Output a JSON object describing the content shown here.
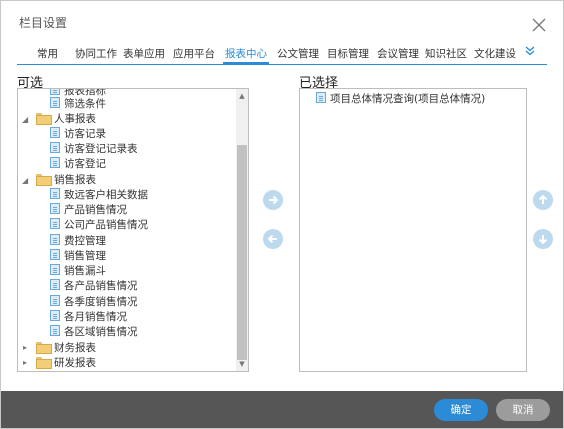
{
  "dialog": {
    "title": "栏目设置"
  },
  "tabs": [
    {
      "label": "常用",
      "active": false
    },
    {
      "label": "协同工作",
      "active": false
    },
    {
      "label": "表单应用",
      "active": false
    },
    {
      "label": "应用平台",
      "active": false
    },
    {
      "label": "报表中心",
      "active": true
    },
    {
      "label": "公文管理",
      "active": false
    },
    {
      "label": "目标管理",
      "active": false
    },
    {
      "label": "会议管理",
      "active": false
    },
    {
      "label": "知识社区",
      "active": false
    },
    {
      "label": "文化建设",
      "active": false
    }
  ],
  "labels": {
    "available": "可选",
    "selected": "已选择"
  },
  "available_tree": [
    {
      "type": "file",
      "label": "报表指标",
      "level": 2
    },
    {
      "type": "file",
      "label": "筛选条件",
      "level": 2
    },
    {
      "type": "folder",
      "label": "人事报表",
      "level": 1,
      "expanded": true
    },
    {
      "type": "file",
      "label": "访客记录",
      "level": 2
    },
    {
      "type": "file",
      "label": "访客登记记录表",
      "level": 2
    },
    {
      "type": "file",
      "label": "访客登记",
      "level": 2
    },
    {
      "type": "folder",
      "label": "销售报表",
      "level": 1,
      "expanded": true
    },
    {
      "type": "file",
      "label": "致远客户相关数据",
      "level": 2
    },
    {
      "type": "file",
      "label": "产品销售情况",
      "level": 2
    },
    {
      "type": "file",
      "label": "公司产品销售情况",
      "level": 2
    },
    {
      "type": "file",
      "label": "费控管理",
      "level": 2
    },
    {
      "type": "file",
      "label": "销售管理",
      "level": 2
    },
    {
      "type": "file",
      "label": "销售漏斗",
      "level": 2
    },
    {
      "type": "file",
      "label": "各产品销售情况",
      "level": 2
    },
    {
      "type": "file",
      "label": "各季度销售情况",
      "level": 2
    },
    {
      "type": "file",
      "label": "各月销售情况",
      "level": 2
    },
    {
      "type": "file",
      "label": "各区域销售情况",
      "level": 2
    },
    {
      "type": "folder",
      "label": "财务报表",
      "level": 1,
      "expanded": false
    },
    {
      "type": "folder",
      "label": "研发报表",
      "level": 1,
      "expanded": false
    }
  ],
  "selected_list": [
    {
      "label": "项目总体情况查询(项目总体情况)"
    }
  ],
  "buttons": {
    "ok": "确定",
    "cancel": "取消"
  },
  "colors": {
    "accent": "#2b8bd6",
    "footer": "#565656",
    "arrow_button": "#bcd9ee"
  }
}
